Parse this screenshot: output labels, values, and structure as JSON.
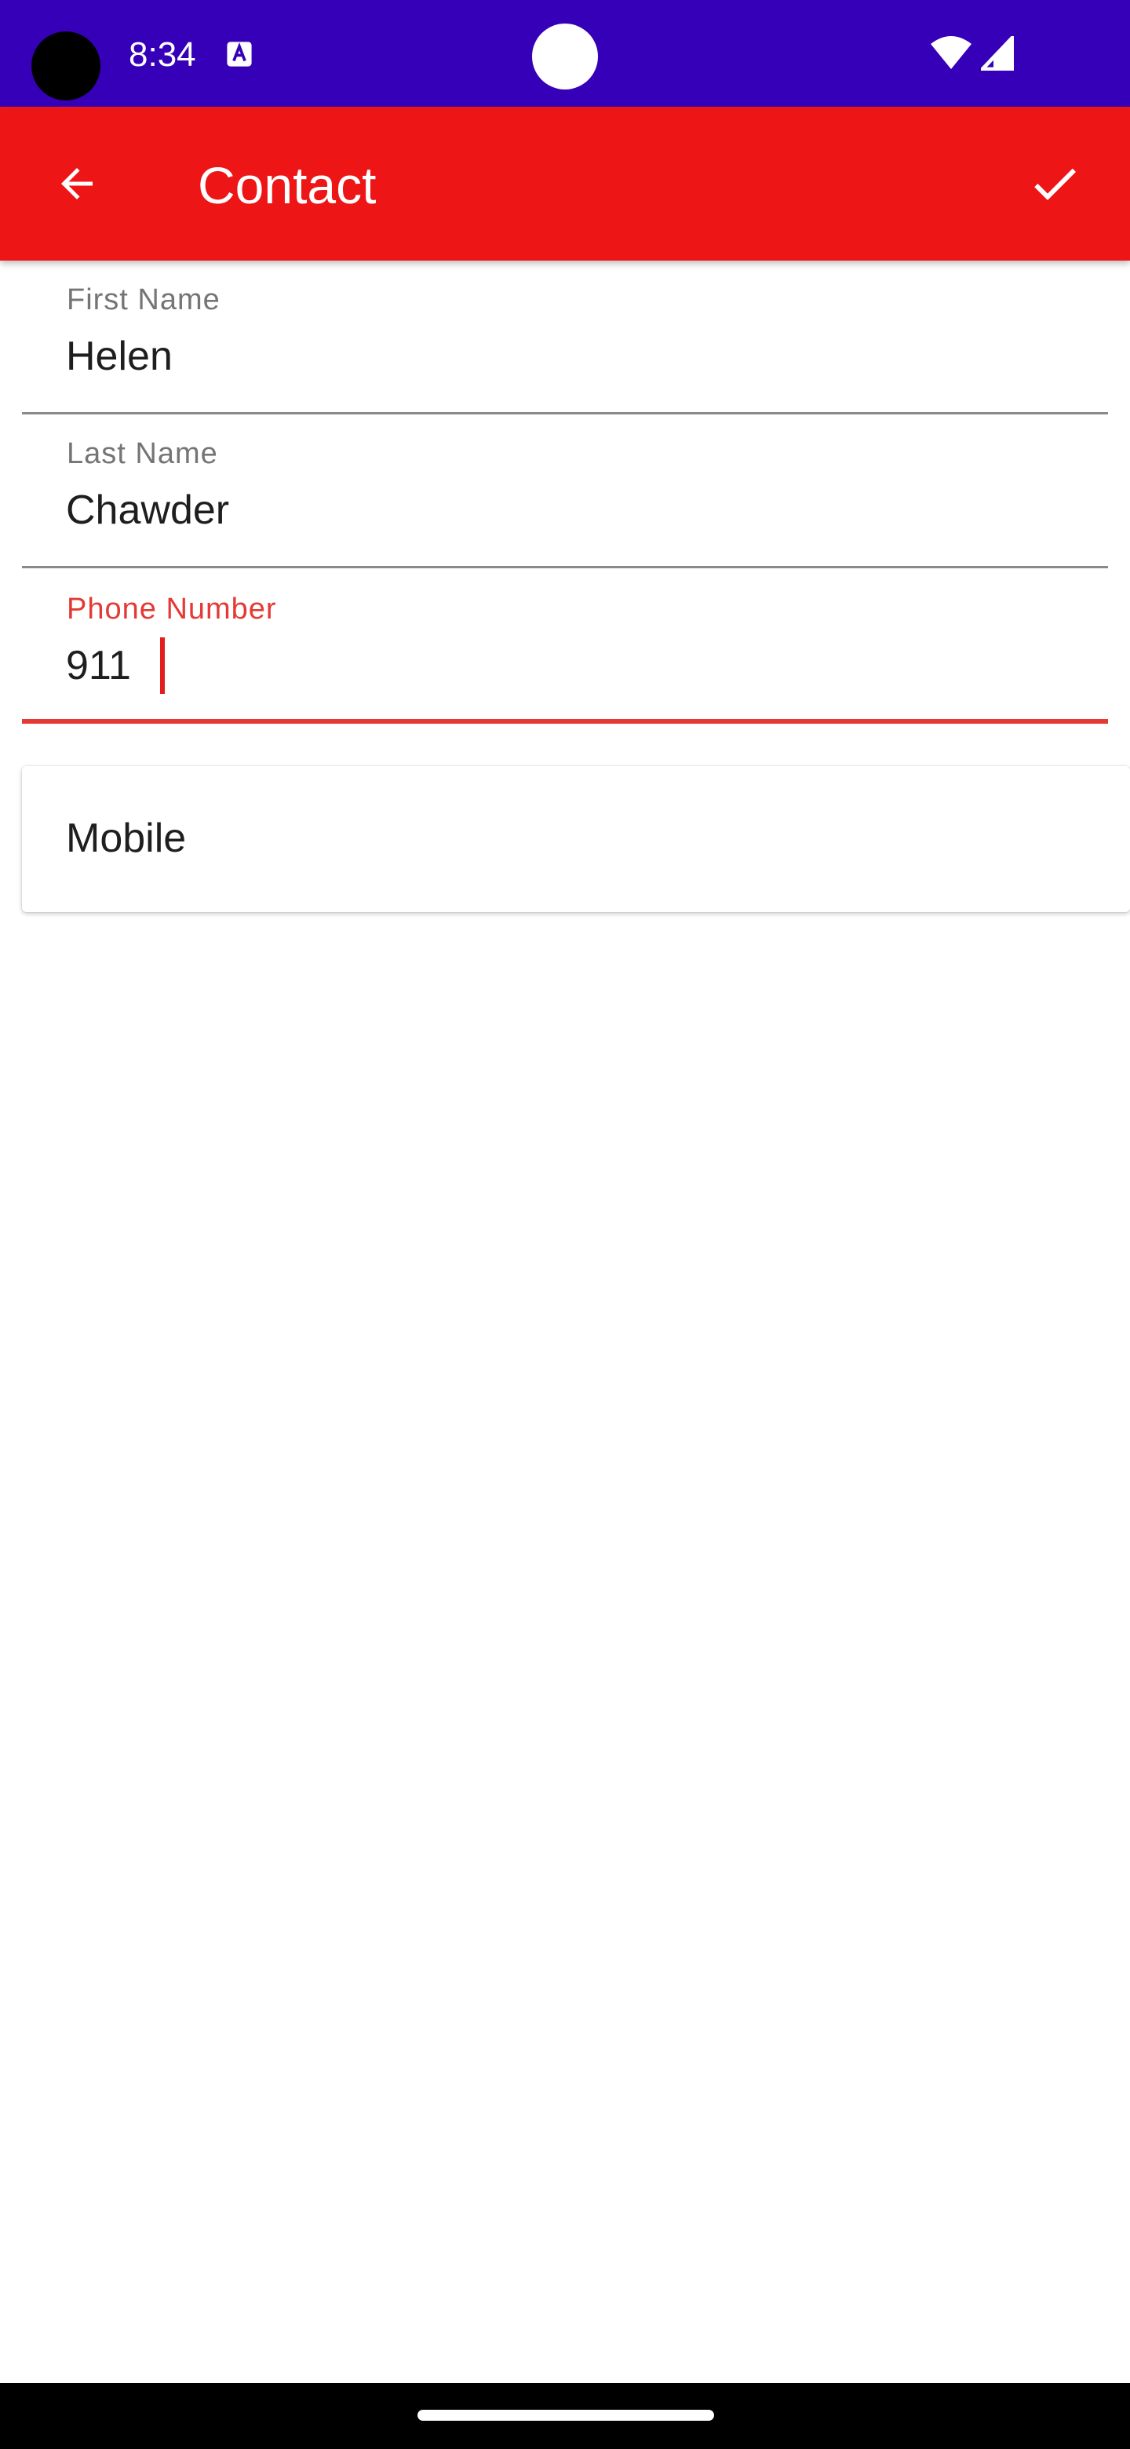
{
  "status_bar": {
    "time": "8:34",
    "icons": [
      "camera-cutout",
      "a-notification-icon",
      "wifi-icon",
      "cellular-signal-icon"
    ]
  },
  "app_bar": {
    "title": "Contact",
    "back_icon": "arrow-back-icon",
    "save_icon": "check-icon",
    "color": "#ed1516"
  },
  "form": {
    "first_name": {
      "label": "First Name",
      "value": "Helen"
    },
    "last_name": {
      "label": "Last Name",
      "value": "Chawder"
    },
    "phone_number": {
      "label": "Phone Number",
      "value": "911"
    },
    "phone_type": {
      "selected": "Mobile"
    }
  },
  "colors": {
    "status_bar": "#3600b8",
    "accent": "#e53935",
    "navigation_bar": "#000000"
  }
}
